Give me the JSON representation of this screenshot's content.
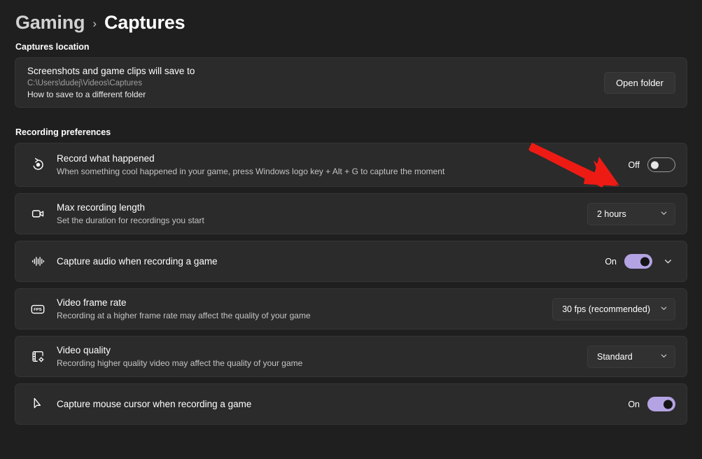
{
  "breadcrumb": {
    "parent": "Gaming",
    "separator": "›",
    "current": "Captures"
  },
  "sections": {
    "captures_location": {
      "label": "Captures location",
      "title": "Screenshots and game clips will save to",
      "path": "C:\\Users\\dudej\\Videos\\Captures",
      "link": "How to save to a different folder",
      "button": "Open folder"
    },
    "recording_preferences": {
      "label": "Recording preferences",
      "rows": [
        {
          "icon": "record-history-icon",
          "title": "Record what happened",
          "subtitle": "When something cool happened in your game, press Windows logo key + Alt + G to capture the moment",
          "control": "toggle",
          "state": "Off",
          "on": false,
          "expander": false
        },
        {
          "icon": "video-camera-icon",
          "title": "Max recording length",
          "subtitle": "Set the duration for recordings you start",
          "control": "dropdown",
          "value": "2 hours",
          "expander": false
        },
        {
          "icon": "audio-waveform-icon",
          "title": "Capture audio when recording a game",
          "subtitle": "",
          "control": "toggle",
          "state": "On",
          "on": true,
          "expander": true
        },
        {
          "icon": "fps-badge-icon",
          "title": "Video frame rate",
          "subtitle": "Recording at a higher frame rate may affect the quality of your game",
          "control": "dropdown",
          "value": "30 fps (recommended)",
          "expander": false
        },
        {
          "icon": "film-gear-icon",
          "title": "Video quality",
          "subtitle": "Recording higher quality video may affect the quality of your game",
          "control": "dropdown",
          "value": "Standard",
          "expander": false
        },
        {
          "icon": "mouse-cursor-icon",
          "title": "Capture mouse cursor when recording a game",
          "subtitle": "",
          "control": "toggle",
          "state": "On",
          "on": true,
          "expander": false
        }
      ]
    }
  },
  "annotation": {
    "type": "red-arrow",
    "color": "#ee1b15",
    "points_to": "record-what-happened-toggle"
  },
  "colors": {
    "page_background": "#1f1f1f",
    "card_background": "#2b2b2b",
    "accent_toggle_on": "#b4a3e3",
    "annotation_red": "#ee1b15"
  }
}
